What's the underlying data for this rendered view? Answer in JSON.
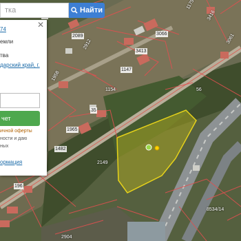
{
  "search": {
    "placeholder_fragment": "тка",
    "button_label": "Найти"
  },
  "panel": {
    "link_top": "74",
    "line1": "емли",
    "line2": "тва",
    "address_link": "дарский край, г.",
    "order_button": "чет",
    "offer_lines": [
      "ичной оферты",
      "ности и даю",
      "ных"
    ],
    "info_link": "ормация"
  },
  "map_labels": {
    "p2089": "2089",
    "p3066": "3066",
    "p2912": "2912",
    "p3413": "3413",
    "p1147": "1147",
    "p1154": "1154",
    "p35": "35",
    "p1965": "1965",
    "p1482": "1482",
    "p2149": "2149",
    "p56": "56",
    "p8534": "8534/14",
    "p196": "196",
    "p2904": "2904",
    "p1958": "1958",
    "p1175": "1175",
    "p3416": "3416",
    "p3061": "3061"
  }
}
